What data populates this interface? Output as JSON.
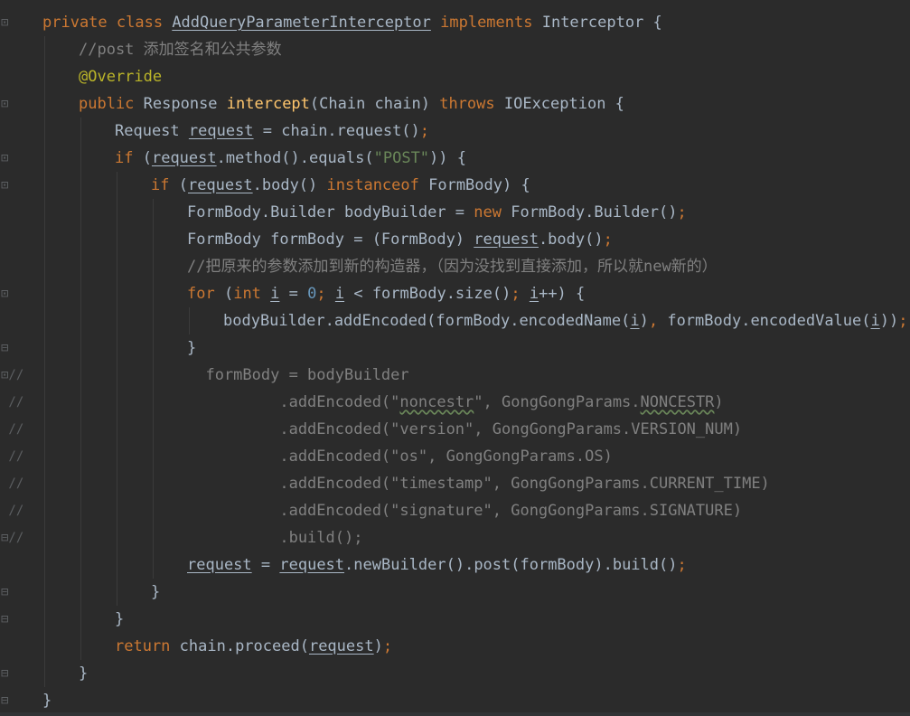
{
  "editor": {
    "theme_colors": {
      "background": "#2b2b2b",
      "keyword": "#cc7832",
      "text": "#a9b7c6",
      "function": "#ffc66d",
      "string": "#6a8759",
      "number": "#6897bb",
      "comment": "#808080",
      "annotation": "#bbb529",
      "static_field": "#9876aa"
    },
    "lines": [
      {
        "gutter": "fold-marker",
        "indent": 0,
        "tokens": [
          {
            "t": "private ",
            "c": "k"
          },
          {
            "t": "class ",
            "c": "k"
          },
          {
            "t": "AddQueryParameterInterceptor",
            "c": "t",
            "u": true
          },
          {
            "t": " implements ",
            "c": "k"
          },
          {
            "t": "Interceptor {",
            "c": "t"
          }
        ]
      },
      {
        "gutter": "",
        "indent": 1,
        "tokens": [
          {
            "t": "//post 添加签名和公共参数",
            "c": "c"
          }
        ]
      },
      {
        "gutter": "",
        "indent": 1,
        "tokens": [
          {
            "t": "@Override",
            "c": "an"
          }
        ]
      },
      {
        "gutter": "fold-marker",
        "indent": 1,
        "tokens": [
          {
            "t": "public ",
            "c": "k"
          },
          {
            "t": "Response ",
            "c": "t"
          },
          {
            "t": "intercept",
            "c": "f"
          },
          {
            "t": "(Chain chain) ",
            "c": "t"
          },
          {
            "t": "throws ",
            "c": "k"
          },
          {
            "t": "IOException {",
            "c": "t"
          }
        ]
      },
      {
        "gutter": "",
        "indent": 2,
        "tokens": [
          {
            "t": "Request ",
            "c": "t"
          },
          {
            "t": "request",
            "c": "t",
            "u": true
          },
          {
            "t": " = chain.request()",
            "c": "t"
          },
          {
            "t": ";",
            "c": "k"
          }
        ]
      },
      {
        "gutter": "fold-marker",
        "indent": 2,
        "tokens": [
          {
            "t": "if ",
            "c": "k"
          },
          {
            "t": "(",
            "c": "t"
          },
          {
            "t": "request",
            "c": "t",
            "u": true
          },
          {
            "t": ".method().equals(",
            "c": "t"
          },
          {
            "t": "\"POST\"",
            "c": "s"
          },
          {
            "t": ")) {",
            "c": "t"
          }
        ]
      },
      {
        "gutter": "fold-marker",
        "indent": 3,
        "tokens": [
          {
            "t": "if ",
            "c": "k"
          },
          {
            "t": "(",
            "c": "t"
          },
          {
            "t": "request",
            "c": "t",
            "u": true
          },
          {
            "t": ".body() ",
            "c": "t"
          },
          {
            "t": "instanceof ",
            "c": "k"
          },
          {
            "t": "FormBody) {",
            "c": "t"
          }
        ]
      },
      {
        "gutter": "",
        "indent": 4,
        "tokens": [
          {
            "t": "FormBody.Builder bodyBuilder = ",
            "c": "t"
          },
          {
            "t": "new ",
            "c": "k"
          },
          {
            "t": "FormBody.Builder()",
            "c": "t"
          },
          {
            "t": ";",
            "c": "k"
          }
        ]
      },
      {
        "gutter": "",
        "indent": 4,
        "tokens": [
          {
            "t": "FormBody formBody = (FormBody) ",
            "c": "t"
          },
          {
            "t": "request",
            "c": "t",
            "u": true
          },
          {
            "t": ".body()",
            "c": "t"
          },
          {
            "t": ";",
            "c": "k"
          }
        ]
      },
      {
        "gutter": "",
        "indent": 4,
        "tokens": [
          {
            "t": "//把原来的参数添加到新的构造器，（因为没找到直接添加，所以就new新的）",
            "c": "c"
          }
        ]
      },
      {
        "gutter": "fold-marker",
        "indent": 4,
        "tokens": [
          {
            "t": "for ",
            "c": "k"
          },
          {
            "t": "(",
            "c": "t"
          },
          {
            "t": "int ",
            "c": "k"
          },
          {
            "t": "i",
            "c": "t",
            "u": true
          },
          {
            "t": " = ",
            "c": "t"
          },
          {
            "t": "0",
            "c": "n"
          },
          {
            "t": "; ",
            "c": "k"
          },
          {
            "t": "i",
            "c": "t",
            "u": true
          },
          {
            "t": " < formBody.size()",
            "c": "t"
          },
          {
            "t": "; ",
            "c": "k"
          },
          {
            "t": "i",
            "c": "t",
            "u": true
          },
          {
            "t": "++) {",
            "c": "t"
          }
        ]
      },
      {
        "gutter": "",
        "indent": 5,
        "tokens": [
          {
            "t": "bodyBuilder.addEncoded(formBody.encodedName(",
            "c": "t"
          },
          {
            "t": "i",
            "c": "t",
            "u": true
          },
          {
            "t": ")",
            "c": "t"
          },
          {
            "t": ", ",
            "c": "k"
          },
          {
            "t": "formBody.encodedValue(",
            "c": "t"
          },
          {
            "t": "i",
            "c": "t",
            "u": true
          },
          {
            "t": "))",
            "c": "t"
          },
          {
            "t": ";",
            "c": "k"
          }
        ]
      },
      {
        "gutter": "fold-end",
        "indent": 4,
        "tokens": [
          {
            "t": "}",
            "c": "t"
          }
        ]
      },
      {
        "gutter": "fold-marker //",
        "indent": 4,
        "tokens": [
          {
            "t": "  formBody = bodyBuilder",
            "c": "c"
          }
        ]
      },
      {
        "gutter": "//",
        "indent": 4,
        "tokens": [
          {
            "t": "          .addEncoded(\"",
            "c": "c"
          },
          {
            "t": "noncestr",
            "c": "c",
            "sq": true
          },
          {
            "t": "\", GongGongParams.",
            "c": "c"
          },
          {
            "t": "NONCESTR",
            "c": "c",
            "sq": true
          },
          {
            "t": ")",
            "c": "c"
          }
        ]
      },
      {
        "gutter": "//",
        "indent": 4,
        "tokens": [
          {
            "t": "          .addEncoded(\"version\", GongGongParams.VERSION_NUM)",
            "c": "c"
          }
        ]
      },
      {
        "gutter": "//",
        "indent": 4,
        "tokens": [
          {
            "t": "          .addEncoded(\"os\", GongGongParams.OS)",
            "c": "c"
          }
        ]
      },
      {
        "gutter": "//",
        "indent": 4,
        "tokens": [
          {
            "t": "          .addEncoded(\"timestamp\", GongGongParams.CURRENT_TIME)",
            "c": "c"
          }
        ]
      },
      {
        "gutter": "//",
        "indent": 4,
        "tokens": [
          {
            "t": "          .addEncoded(\"signature\", GongGongParams.SIGNATURE)",
            "c": "c"
          }
        ]
      },
      {
        "gutter": "fold-end //",
        "indent": 4,
        "tokens": [
          {
            "t": "          .build();",
            "c": "c"
          }
        ]
      },
      {
        "gutter": "",
        "indent": 4,
        "tokens": [
          {
            "t": "request",
            "c": "t",
            "u": true
          },
          {
            "t": " = ",
            "c": "t"
          },
          {
            "t": "request",
            "c": "t",
            "u": true
          },
          {
            "t": ".newBuilder().post(formBody).build()",
            "c": "t"
          },
          {
            "t": ";",
            "c": "k"
          }
        ]
      },
      {
        "gutter": "fold-end",
        "indent": 3,
        "tokens": [
          {
            "t": "}",
            "c": "t"
          }
        ]
      },
      {
        "gutter": "fold-end",
        "indent": 2,
        "tokens": [
          {
            "t": "}",
            "c": "t"
          }
        ]
      },
      {
        "gutter": "",
        "indent": 2,
        "tokens": [
          {
            "t": "return ",
            "c": "k"
          },
          {
            "t": "chain.proceed(",
            "c": "t"
          },
          {
            "t": "request",
            "c": "t",
            "u": true
          },
          {
            "t": ")",
            "c": "t"
          },
          {
            "t": ";",
            "c": "k"
          }
        ]
      },
      {
        "gutter": "fold-end",
        "indent": 1,
        "tokens": [
          {
            "t": "}",
            "c": "t"
          }
        ]
      },
      {
        "gutter": "fold-end",
        "indent": 0,
        "tokens": [
          {
            "t": "}",
            "c": "t"
          }
        ]
      }
    ]
  }
}
